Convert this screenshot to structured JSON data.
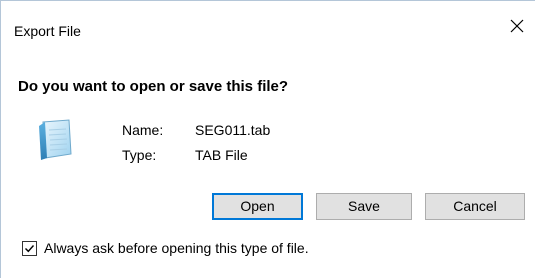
{
  "dialog": {
    "title": "Export File",
    "prompt": "Do you want to open or save this file?",
    "file": {
      "icon": "notepad-file-icon",
      "name_label": "Name:",
      "name_value": "SEG011.tab",
      "type_label": "Type:",
      "type_value": "TAB File"
    },
    "buttons": {
      "open": "Open",
      "save": "Save",
      "cancel": "Cancel"
    },
    "always_ask": {
      "checked": true,
      "label": "Always ask before opening this type of file."
    },
    "close_icon": "close-icon",
    "colors": {
      "focus_border": "#0078d7",
      "button_bg": "#e1e1e1"
    }
  }
}
